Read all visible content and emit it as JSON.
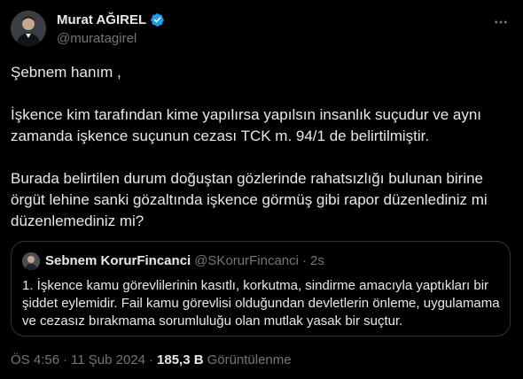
{
  "author": {
    "name": "Murat AĞIREL",
    "handle": "@muratagirel",
    "verified": true,
    "verified_color": "#1d9bf0"
  },
  "tweet": {
    "paragraphs": [
      "Şebnem hanım ,",
      "İşkence kim tarafından kime yapılırsa yapılsın insanlık suçudur ve aynı zamanda işkence suçunun cezası TCK m. 94/1 de belirtilmiştir.",
      "Burada  belirtilen durum doğuştan gözlerinde rahatsızlığı bulunan birine örgüt lehine sanki gözaltında  işkence görmüş gibi rapor düzenlediniz mi düzenlemediniz mi?"
    ]
  },
  "quoted_tweet": {
    "name": "Sebnem KorurFincanci",
    "handle": "@SKorurFincanci",
    "separator": "·",
    "time": "2s",
    "text": "1. İşkence kamu görevlilerinin kasıtlı, korkutma, sindirme amacıyla yaptıkları bir şiddet eylemidir. Fail kamu görevlisi olduğundan devletlerin önleme, uygulamama ve cezasız bırakmama sorumluluğu olan mutlak yasak bir suçtur."
  },
  "meta": {
    "time": "ÖS 4:56",
    "separator": "·",
    "date": "11 Şub 2024",
    "views_count": "185,3 B",
    "views_label": "Görüntülenme"
  },
  "icons": {
    "more": "more-icon",
    "verified": "verified-badge-icon"
  },
  "colors": {
    "background": "#000000",
    "text": "#e7e9ea",
    "muted": "#71767b",
    "border": "#2f3336",
    "accent": "#1d9bf0"
  }
}
